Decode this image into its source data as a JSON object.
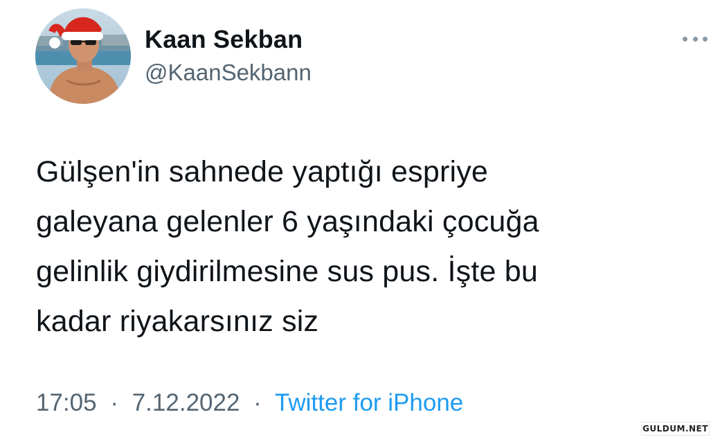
{
  "author": {
    "display_name": "Kaan Sekban",
    "handle": "@KaanSekbann"
  },
  "tweet": {
    "text_lines": [
      "Gülşen'in sahnede yaptığı espriye",
      "galeyana gelenler 6 yaşındaki çocuğa",
      "gelinlik giydirilmesine sus pus. İşte bu",
      "kadar riyakarsınız siz"
    ]
  },
  "meta": {
    "time": "17:05",
    "separator": "·",
    "date": "7.12.2022",
    "source": "Twitter for iPhone"
  },
  "icons": {
    "more": "more-options-icon"
  },
  "colors": {
    "text": "#0f1419",
    "secondary": "#536471",
    "link": "#1d9bf0"
  },
  "watermark": "GULDUM.NET"
}
